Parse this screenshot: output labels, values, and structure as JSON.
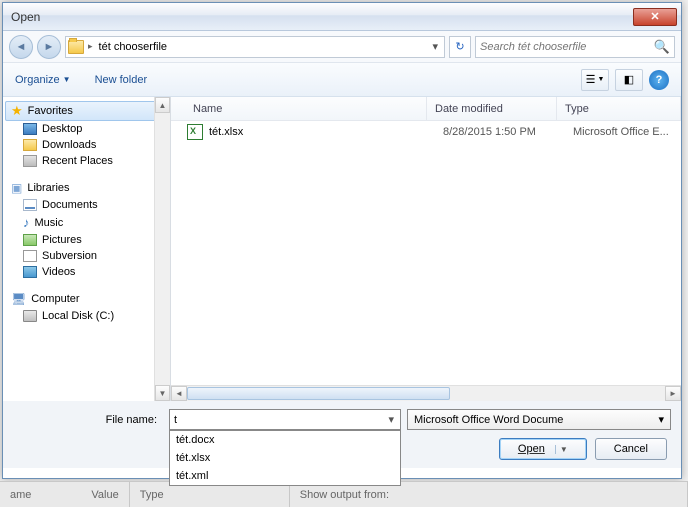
{
  "titlebar": {
    "title": "Open"
  },
  "nav": {
    "crumb": "tét chooserfile",
    "search_placeholder": "Search tét chooserfile"
  },
  "toolbar": {
    "organize": "Organize",
    "newfolder": "New folder"
  },
  "sidebar": {
    "favorites": {
      "header": "Favorites",
      "items": [
        "Desktop",
        "Downloads",
        "Recent Places"
      ]
    },
    "libraries": {
      "header": "Libraries",
      "items": [
        "Documents",
        "Music",
        "Pictures",
        "Subversion",
        "Videos"
      ]
    },
    "computer": {
      "header": "Computer",
      "items": [
        "Local Disk (C:)"
      ]
    }
  },
  "columns": {
    "name": "Name",
    "date": "Date modified",
    "type": "Type"
  },
  "files": [
    {
      "name": "tét.xlsx",
      "date": "8/28/2015 1:50 PM",
      "type": "Microsoft Office E..."
    }
  ],
  "footer": {
    "filename_label": "File name:",
    "filename_value": "t",
    "filter": "Microsoft Office Word Docume",
    "open": "Open",
    "cancel": "Cancel",
    "autocomplete": [
      "tét.docx",
      "tét.xlsx",
      "tét.xml"
    ]
  },
  "bottom": {
    "name": "ame",
    "value": "Value",
    "type": "Type",
    "show_output": "Show output from:"
  }
}
